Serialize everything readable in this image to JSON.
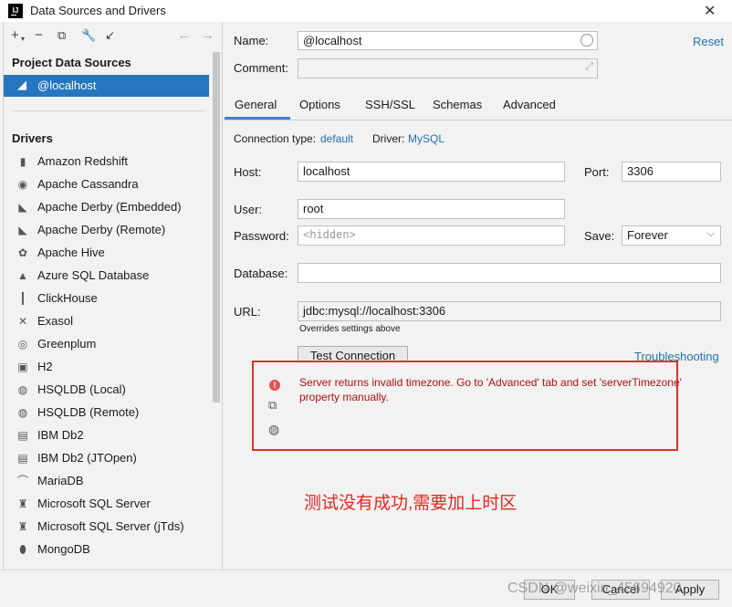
{
  "window": {
    "title": "Data Sources and Drivers"
  },
  "left": {
    "project_header": "Project Data Sources",
    "selected_source": "@localhost",
    "drivers_header": "Drivers",
    "drivers": [
      {
        "label": "Amazon Redshift",
        "icon": "redshift-icon"
      },
      {
        "label": "Apache Cassandra",
        "icon": "cassandra-icon"
      },
      {
        "label": "Apache Derby (Embedded)",
        "icon": "derby-icon"
      },
      {
        "label": "Apache Derby (Remote)",
        "icon": "derby-icon"
      },
      {
        "label": "Apache Hive",
        "icon": "hive-icon"
      },
      {
        "label": "Azure SQL Database",
        "icon": "azure-icon"
      },
      {
        "label": "ClickHouse",
        "icon": "clickhouse-icon"
      },
      {
        "label": "Exasol",
        "icon": "exasol-icon"
      },
      {
        "label": "Greenplum",
        "icon": "greenplum-icon"
      },
      {
        "label": "H2",
        "icon": "h2-icon"
      },
      {
        "label": "HSQLDB (Local)",
        "icon": "hsqldb-icon"
      },
      {
        "label": "HSQLDB (Remote)",
        "icon": "hsqldb-icon"
      },
      {
        "label": "IBM Db2",
        "icon": "ibm-icon"
      },
      {
        "label": "IBM Db2 (JTOpen)",
        "icon": "ibm-icon"
      },
      {
        "label": "MariaDB",
        "icon": "mariadb-icon"
      },
      {
        "label": "Microsoft SQL Server",
        "icon": "mssql-icon"
      },
      {
        "label": "Microsoft SQL Server (jTds)",
        "icon": "mssql-icon"
      },
      {
        "label": "MongoDB",
        "icon": "mongodb-icon"
      }
    ]
  },
  "form": {
    "name_label": "Name:",
    "name_value": "@localhost",
    "comment_label": "Comment:",
    "reset": "Reset",
    "tabs": [
      "General",
      "Options",
      "SSH/SSL",
      "Schemas",
      "Advanced"
    ],
    "conn_type_label": "Connection type:",
    "conn_type_value": "default",
    "driver_label": "Driver:",
    "driver_value": "MySQL",
    "host_label": "Host:",
    "host_value": "localhost",
    "port_label": "Port:",
    "port_value": "3306",
    "user_label": "User:",
    "user_value": "root",
    "password_label": "Password:",
    "password_placeholder": "<hidden>",
    "save_label": "Save:",
    "save_value": "Forever",
    "database_label": "Database:",
    "url_label": "URL:",
    "url_value": "jdbc:mysql://localhost:3306",
    "url_hint": "Overrides settings above",
    "test_button": "Test Connection",
    "troubleshooting": "Troubleshooting"
  },
  "error": {
    "message": "Server returns invalid timezone. Go to 'Advanced' tab and set 'serverTimezone' property manually."
  },
  "annotation": "测试没有成功,需要加上时区",
  "bottom": {
    "ok": "OK",
    "cancel": "Cancel",
    "apply": "Apply",
    "watermark": "CSDN @weixin_45694920"
  },
  "colors": {
    "selection": "#2675bf",
    "link": "#2470b3",
    "error": "#b01010",
    "annotation": "#e8261e"
  }
}
